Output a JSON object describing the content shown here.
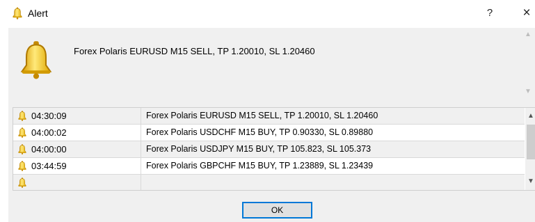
{
  "window": {
    "title": "Alert",
    "help_label": "?",
    "close_label": "×"
  },
  "message": {
    "text": "Forex Polaris EURUSD M15 SELL, TP 1.20010, SL 1.20460"
  },
  "alerts": [
    {
      "time": "04:30:09",
      "text": "Forex Polaris EURUSD M15 SELL, TP 1.20010, SL 1.20460"
    },
    {
      "time": "04:00:02",
      "text": "Forex Polaris USDCHF M15 BUY, TP 0.90330, SL 0.89880"
    },
    {
      "time": "04:00:00",
      "text": "Forex Polaris USDJPY M15 BUY, TP 105.823, SL 105.373"
    },
    {
      "time": "03:44:59",
      "text": "Forex Polaris GBPCHF M15 BUY, TP 1.23889, SL 1.23439"
    }
  ],
  "buttons": {
    "ok_label": "OK"
  },
  "icons": {
    "bell": "bell-icon",
    "bell_color": "#f2b600"
  }
}
